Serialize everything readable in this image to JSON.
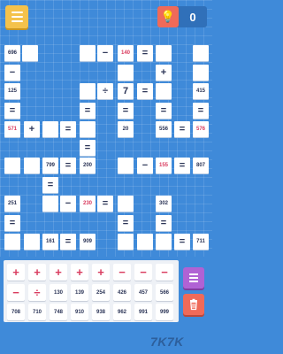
{
  "header": {
    "menu_icon": "hamburger-menu-icon",
    "hint_icon": "lightbulb-icon",
    "hint_count": "0"
  },
  "colors": {
    "board": "#3f8ad9",
    "menu": "#f4c24b",
    "hint": "#ef6a59",
    "red_text": "#d93b5e",
    "dark_text": "#2c3557",
    "history": "#b062d4",
    "trash": "#ef6a59"
  },
  "grid": {
    "values": [
      "696",
      "−",
      "140",
      "=",
      "−",
      "+",
      "125",
      "÷",
      "7",
      "=",
      "415",
      "=",
      "=",
      "=",
      "=",
      "=",
      "571",
      "+",
      "=",
      "20",
      "556",
      "=",
      "576",
      "=",
      "799",
      "=",
      "200",
      "−",
      "155",
      "=",
      "807",
      "=",
      "251",
      "−",
      "230",
      "=",
      "302",
      "=",
      "=",
      "=",
      "161",
      "=",
      "909",
      "=",
      "711"
    ]
  },
  "tray": {
    "row1": [
      "+",
      "+",
      "+",
      "+",
      "+",
      "−",
      "−",
      "−"
    ],
    "row2": [
      "−",
      "÷",
      "130",
      "139",
      "254",
      "426",
      "457",
      "566"
    ],
    "row3": [
      "708",
      "710",
      "748",
      "910",
      "938",
      "962",
      "991",
      "999"
    ]
  },
  "watermark": "7K7K"
}
